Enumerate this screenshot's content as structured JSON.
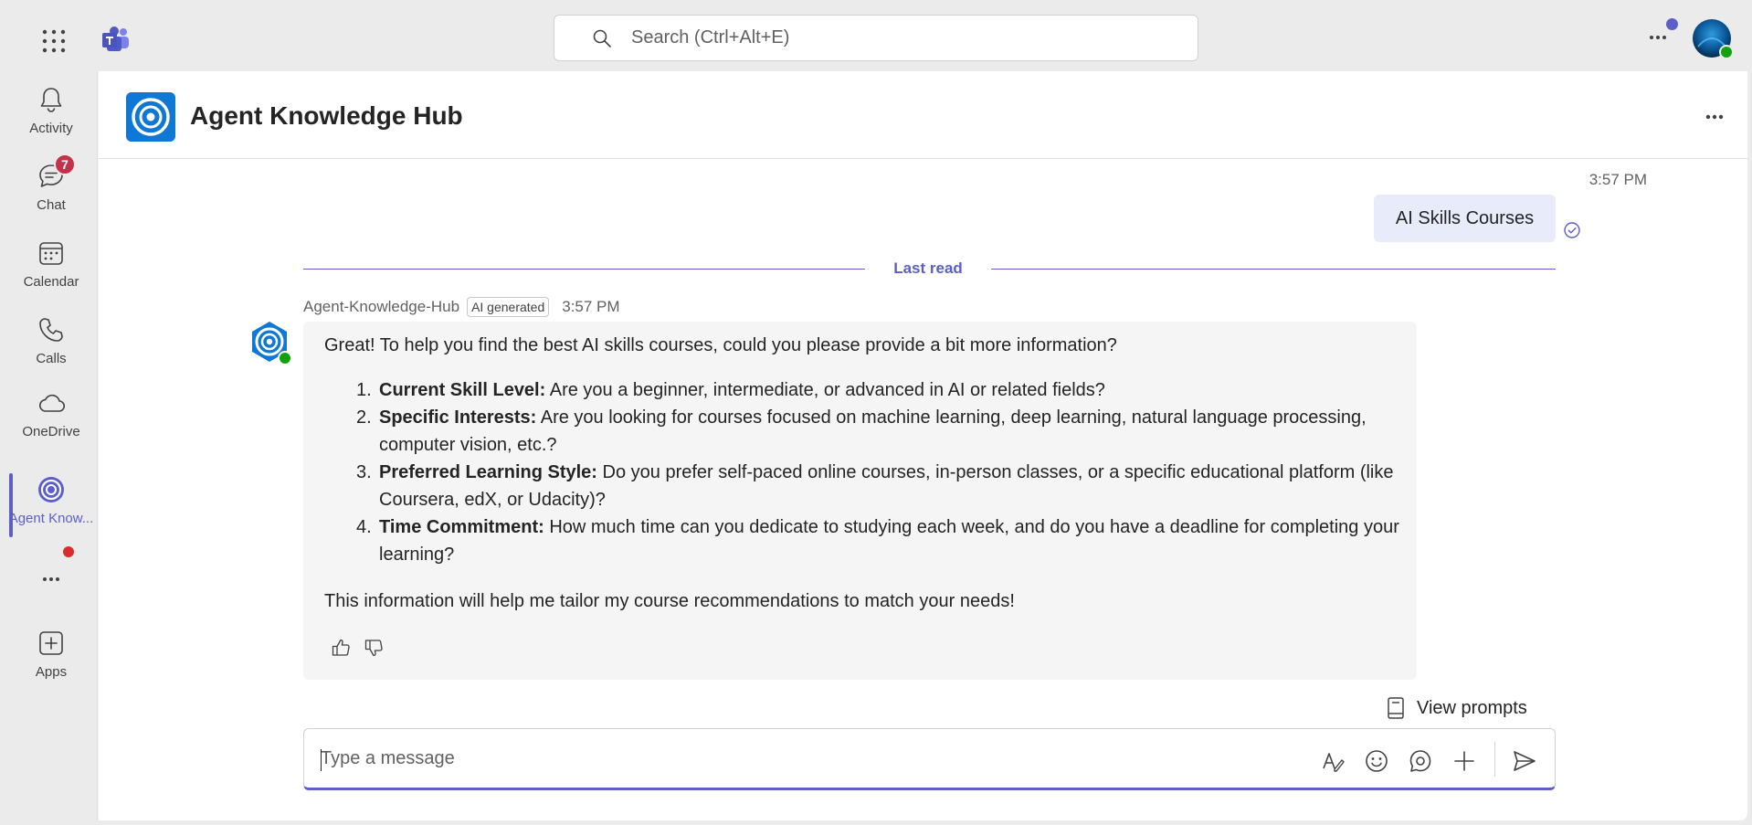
{
  "topbar": {
    "search_placeholder": "Search (Ctrl+Alt+E)"
  },
  "rail": {
    "items": [
      {
        "label": "Activity",
        "icon": "bell-icon"
      },
      {
        "label": "Chat",
        "icon": "chat-icon",
        "badge": "7"
      },
      {
        "label": "Calendar",
        "icon": "calendar-icon"
      },
      {
        "label": "Calls",
        "icon": "phone-icon"
      },
      {
        "label": "OneDrive",
        "icon": "cloud-icon"
      },
      {
        "label": "Agent Know...",
        "icon": "agent-icon",
        "active": true
      },
      {
        "label": "",
        "icon": "more-icon"
      },
      {
        "label": "Apps",
        "icon": "add-app-icon"
      }
    ]
  },
  "header": {
    "title": "Agent Knowledge Hub"
  },
  "conversation": {
    "user_message": {
      "time": "3:57 PM",
      "text": "AI Skills Courses"
    },
    "divider": "Last read",
    "bot_message": {
      "sender": "Agent-Knowledge-Hub",
      "tag": "AI generated",
      "time": "3:57 PM",
      "intro": "Great! To help you find the best AI skills courses, could you please provide a bit more information?",
      "items": [
        {
          "num": "1.",
          "title": "Current Skill Level:",
          "text": " Are you a beginner, intermediate, or advanced in AI or related fields?"
        },
        {
          "num": "2.",
          "title": "Specific Interests:",
          "text": " Are you looking for courses focused on machine learning, deep learning, natural language processing, computer vision, etc.?"
        },
        {
          "num": "3.",
          "title": "Preferred Learning Style:",
          "text": " Do you prefer self-paced online courses, in-person classes, or a specific educational platform (like Coursera, edX, or Udacity)?"
        },
        {
          "num": "4.",
          "title": "Time Commitment:",
          "text": " How much time can you dedicate to studying each week, and do you have a deadline for completing your learning?"
        }
      ],
      "outro": "This information will help me tailor my course recommendations to match your needs!"
    }
  },
  "composer": {
    "view_prompts": "View prompts",
    "placeholder": "Type a message"
  },
  "colors": {
    "accent": "#5b5fc7",
    "badge": "#c4314b",
    "presence": "#13a10e",
    "hub_logo": "#0f78d4"
  }
}
